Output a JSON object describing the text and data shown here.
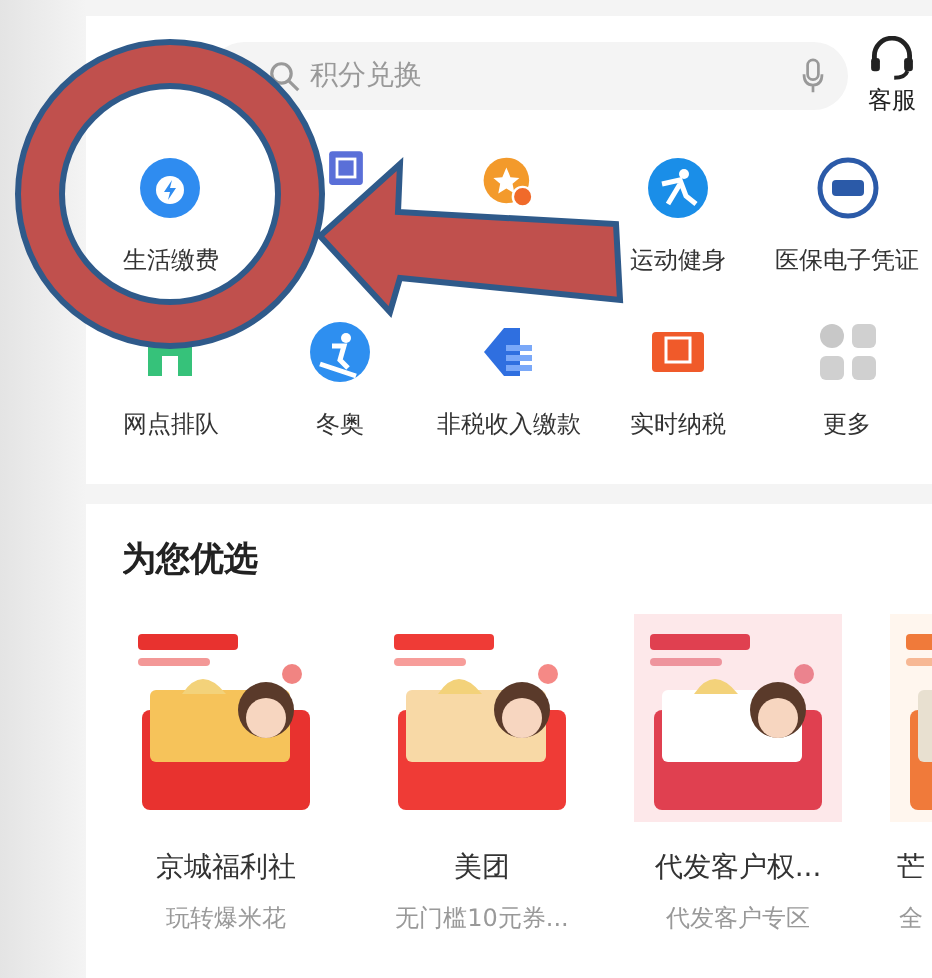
{
  "search": {
    "placeholder": "积分兑换"
  },
  "service": {
    "label": "客服"
  },
  "shortcuts": [
    {
      "kind": "bolt",
      "label": "生活缴费"
    },
    {
      "kind": "coupon"
    },
    {
      "kind": "star"
    },
    {
      "kind": "runner",
      "label": "运动健身"
    },
    {
      "kind": "badge",
      "label": "医保电子凭证"
    },
    {
      "kind": "building",
      "label": "网点排队"
    },
    {
      "kind": "skier",
      "label": "冬奥"
    },
    {
      "kind": "card",
      "label": "非税收入缴款"
    },
    {
      "kind": "receipt",
      "label": "实时纳税"
    },
    {
      "kind": "grid",
      "label": "更多"
    }
  ],
  "section": {
    "title": "为您优选"
  },
  "cards": [
    {
      "title": "京城福利社",
      "subtitle": "玩转爆米花",
      "kind": "picture"
    },
    {
      "title": "美团",
      "subtitle": "无门槛10元券...",
      "kind": "picture"
    },
    {
      "title": "代发客户权...",
      "subtitle": "代发客户专区",
      "kind": "picture"
    },
    {
      "title": "芒",
      "subtitle": "全",
      "kind": "picture"
    }
  ],
  "annotation": {
    "kind": "circle-arrow"
  }
}
